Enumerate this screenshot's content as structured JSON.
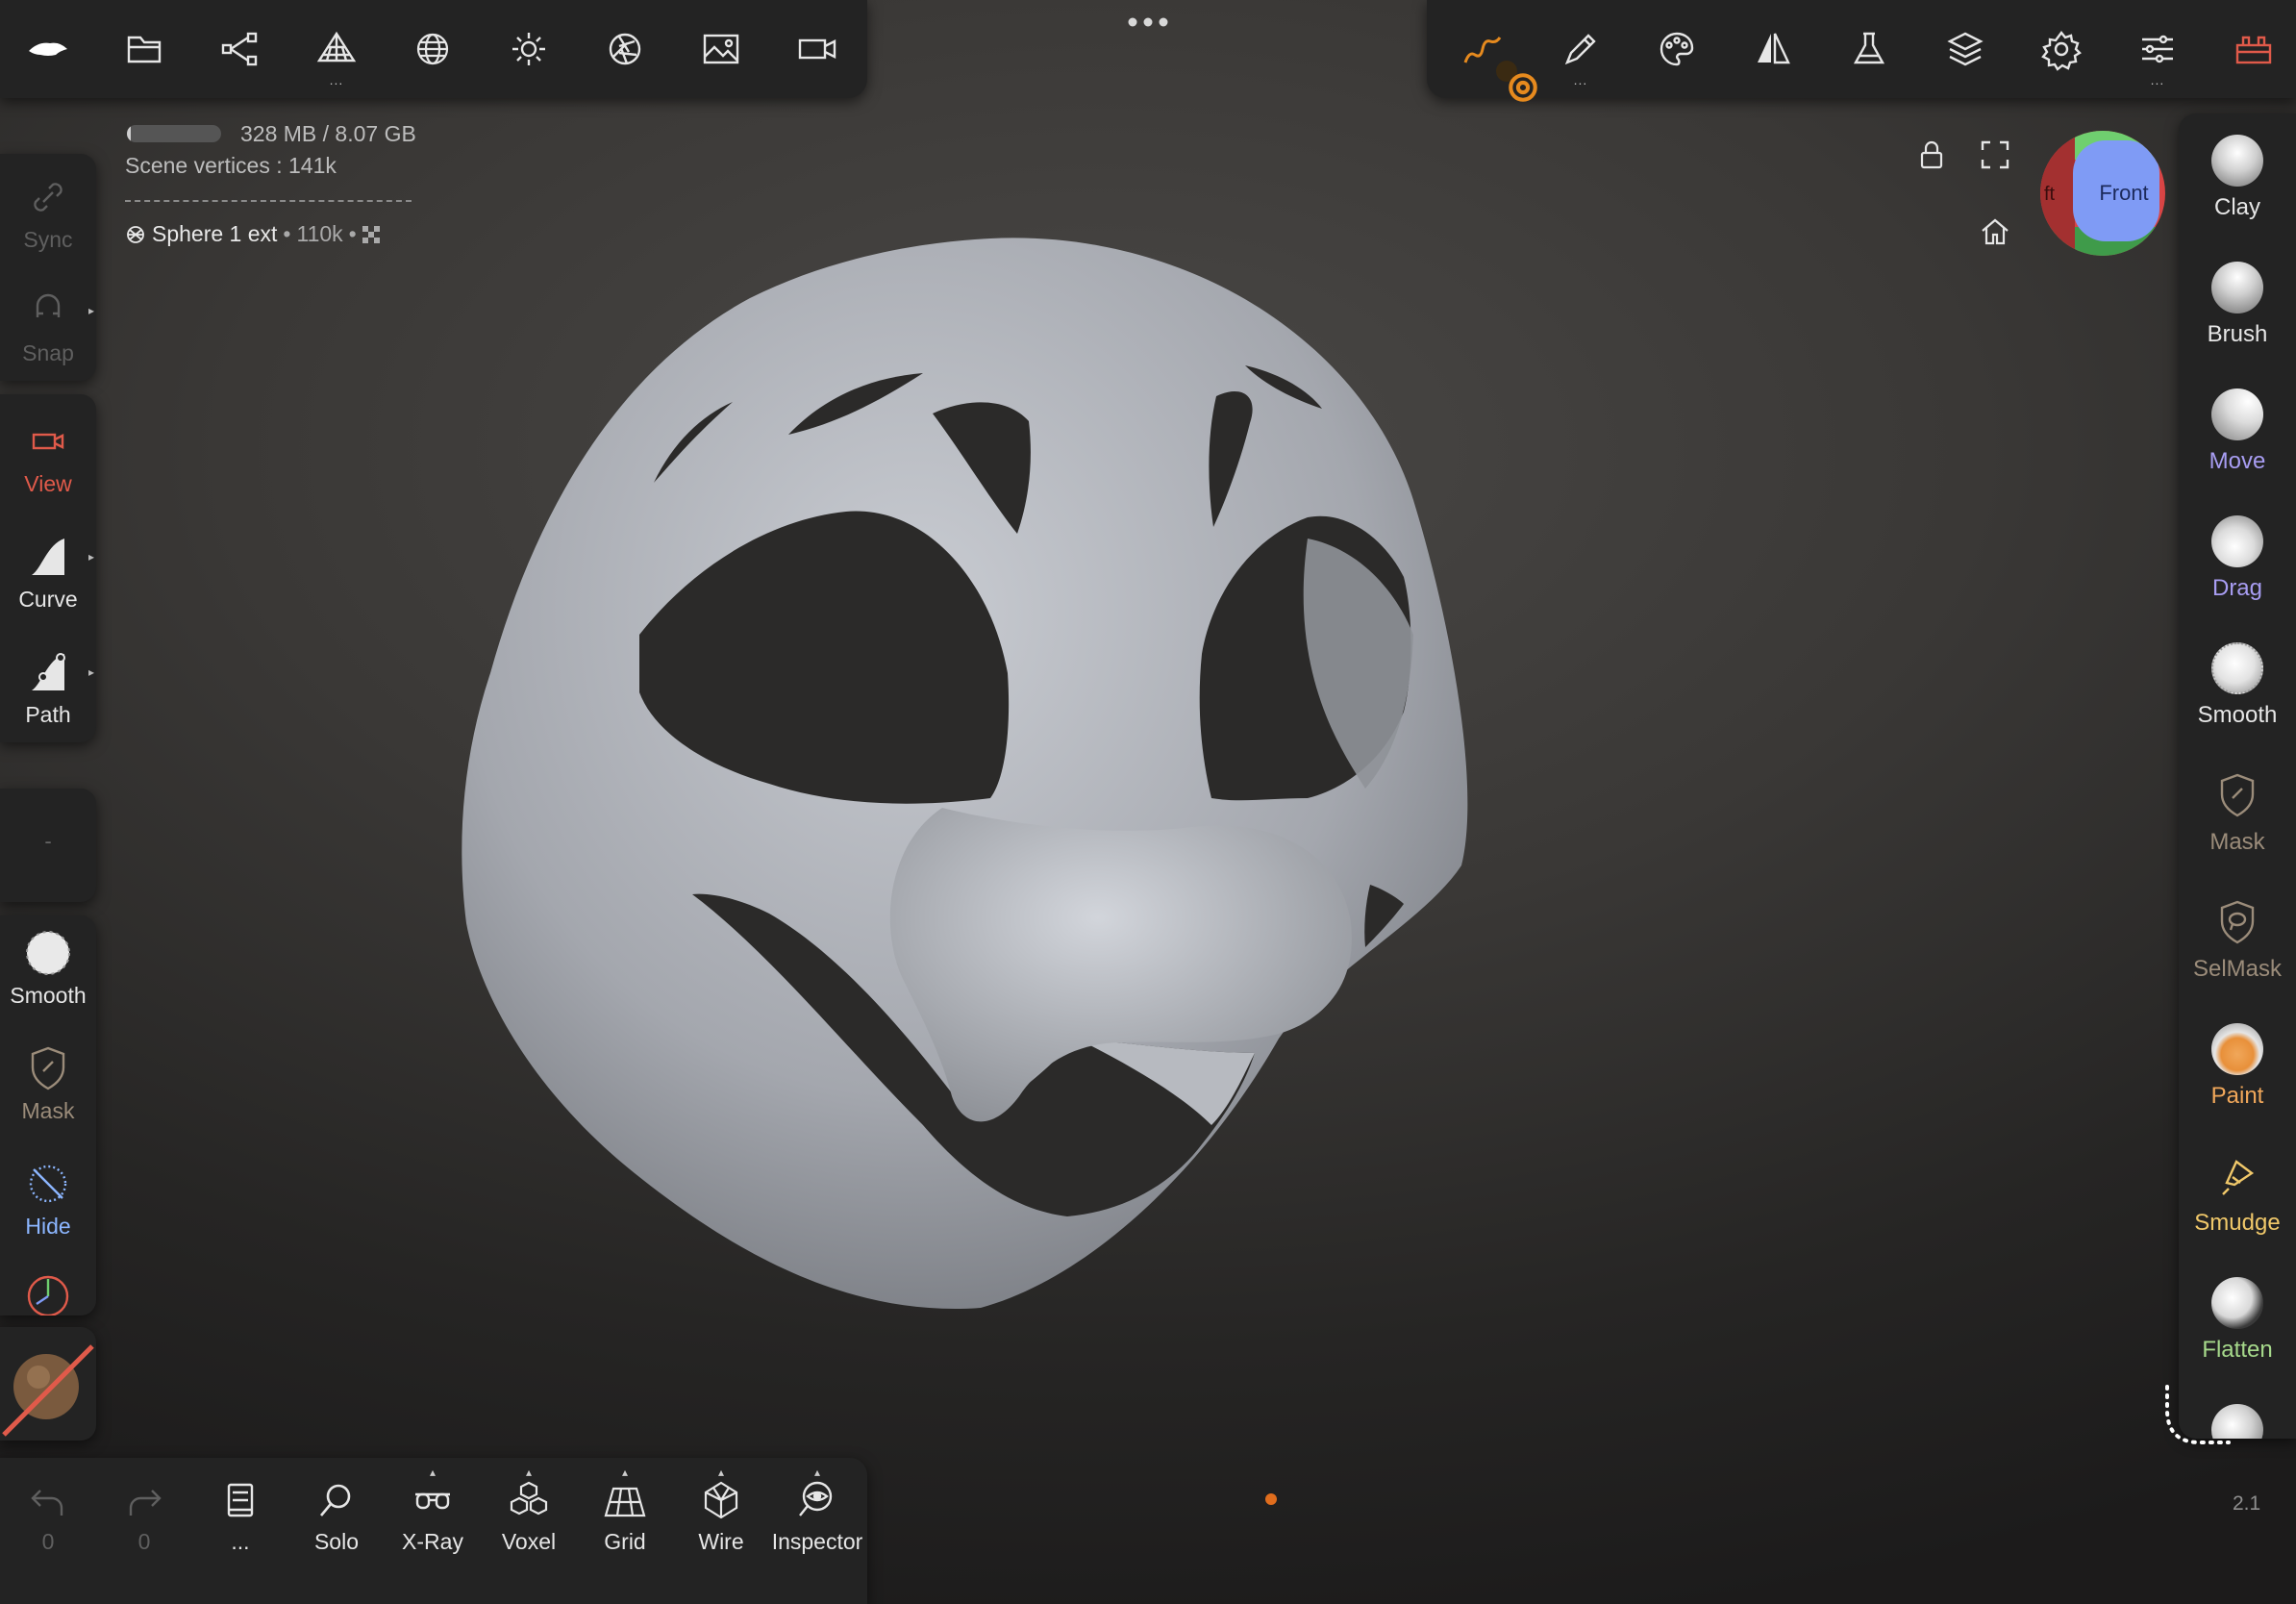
{
  "top_left_toolbar": {
    "items": [
      {
        "icon": "app-logo-icon"
      },
      {
        "icon": "folder-icon"
      },
      {
        "icon": "scene-tree-icon"
      },
      {
        "icon": "topology-icon",
        "more": "..."
      },
      {
        "icon": "mesh-sphere-icon"
      },
      {
        "icon": "light-icon"
      },
      {
        "icon": "camera-aperture-icon"
      },
      {
        "icon": "image-icon"
      },
      {
        "icon": "video-camera-icon"
      }
    ]
  },
  "top_right_toolbar": {
    "items": [
      {
        "icon": "stroke-icon",
        "active": true
      },
      {
        "icon": "brush-settings-icon",
        "more": "..."
      },
      {
        "icon": "palette-icon"
      },
      {
        "icon": "symmetry-icon"
      },
      {
        "icon": "flask-icon"
      },
      {
        "icon": "layers-icon"
      },
      {
        "icon": "settings-icon"
      },
      {
        "icon": "sliders-icon",
        "more": "..."
      },
      {
        "icon": "toolbox-icon"
      }
    ]
  },
  "scene_info": {
    "memory_usage": "328 MB / 8.07 GB",
    "memory_fraction": 0.04,
    "vertices_label": "Scene vertices : 141k",
    "object_name": "Sphere 1 ext",
    "object_vertices": "110k"
  },
  "left_tools": {
    "sync": "Sync",
    "snap": "Snap",
    "view": "View",
    "curve": "Curve",
    "path": "Path",
    "empty_slot": "-",
    "smooth": "Smooth",
    "mask": "Mask",
    "hide": "Hide"
  },
  "right_tools": [
    {
      "label": "Clay",
      "color": "#e6e6e6"
    },
    {
      "label": "Brush",
      "color": "#e6e6e6"
    },
    {
      "label": "Move",
      "color": "#a89df2"
    },
    {
      "label": "Drag",
      "color": "#a89df2"
    },
    {
      "label": "Smooth",
      "color": "#e6e6e6"
    },
    {
      "label": "Mask",
      "color": "#9b8c7a"
    },
    {
      "label": "SelMask",
      "color": "#9b8c7a"
    },
    {
      "label": "Paint",
      "color": "#f0a75a"
    },
    {
      "label": "Smudge",
      "color": "#f0c86a"
    },
    {
      "label": "Flatten",
      "color": "#a6d98b"
    }
  ],
  "bottom_toolbar": {
    "undo_count": "0",
    "redo_count": "0",
    "doc_more": "...",
    "solo": "Solo",
    "xray": "X-Ray",
    "voxel": "Voxel",
    "grid": "Grid",
    "wire": "Wire",
    "inspector": "Inspector"
  },
  "viewcube": {
    "front": "Front",
    "left": "ft"
  },
  "version": "2.1",
  "colors": {
    "accent_orange": "#e68a1e",
    "view_red": "#e05a4a",
    "panel_bg": "#232323",
    "move_purple": "#a89df2",
    "mask_brown": "#9b8c7a",
    "flatten_green": "#a6d98b",
    "hide_blue": "#8cb6ff"
  }
}
